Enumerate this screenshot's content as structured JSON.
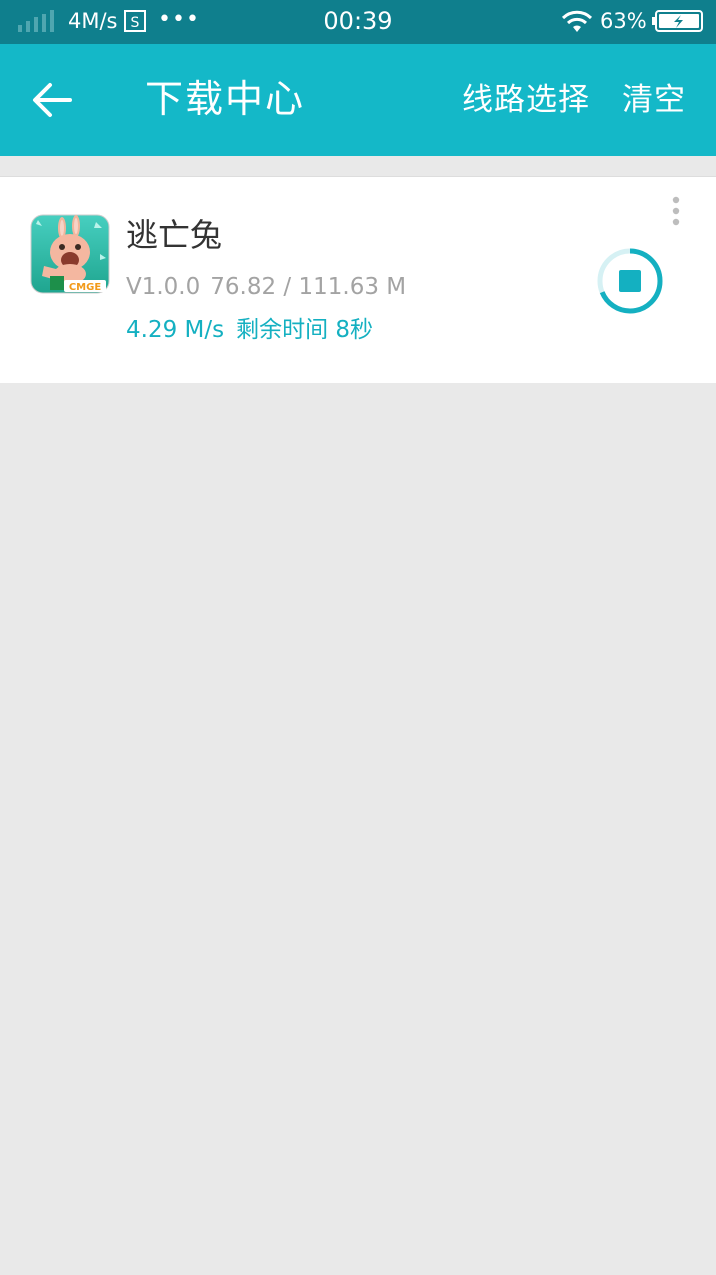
{
  "status_bar": {
    "net_speed": "4M/s",
    "dots": "•••",
    "time": "00:39",
    "battery": "63%",
    "icons": [
      "signal-icon",
      "screenshot-s-icon",
      "wifi-icon",
      "battery-charging-icon"
    ]
  },
  "app_bar": {
    "back_icon": "arrow-left-icon",
    "title": "下载中心",
    "route_select": "线路选择",
    "clear": "清空"
  },
  "colors": {
    "status_bar_bg": "#0f7f8d",
    "app_bar_bg": "#14b8c8",
    "accent": "#14b0c1",
    "page_bg": "#e9e9e9"
  },
  "downloads": [
    {
      "name": "逃亡兔",
      "version": "V1.0.0",
      "size_progress": "76.82 / 111.63 M",
      "speed": "4.29 M/s",
      "remaining": "剩余时间 8秒",
      "progress_fraction": 0.688,
      "icon_label": "CMGE",
      "action_icon": "stop-icon",
      "menu_icon": "more-vertical-icon"
    }
  ]
}
